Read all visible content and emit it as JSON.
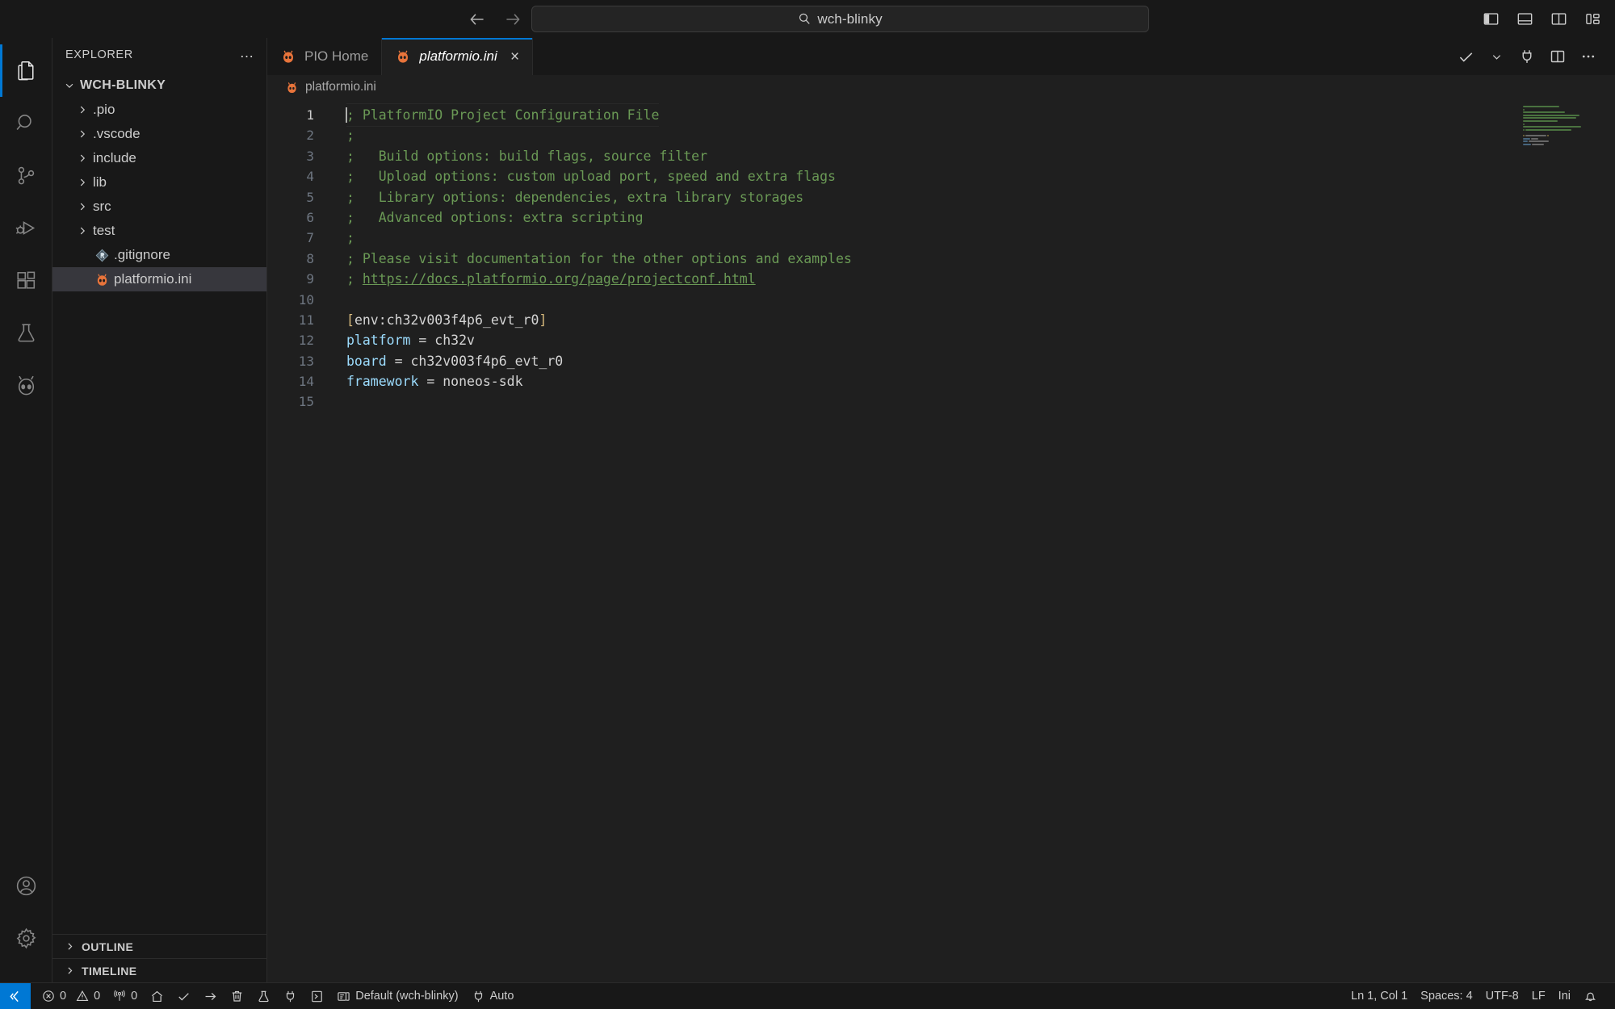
{
  "titlebar": {
    "back_label": "Go Back",
    "forward_label": "Go Forward",
    "search": {
      "value": "wch-blinky",
      "placeholder": "Search",
      "icon": "search-icon"
    },
    "layout_buttons": [
      {
        "name": "toggle-primary-sidebar",
        "label": "Toggle Primary Side Bar"
      },
      {
        "name": "toggle-panel",
        "label": "Toggle Panel"
      },
      {
        "name": "toggle-secondary-sidebar",
        "label": "Toggle Secondary Side Bar"
      },
      {
        "name": "customize-layout",
        "label": "Customize Layout"
      }
    ]
  },
  "activitybar": {
    "items": [
      {
        "name": "explorer",
        "icon": "files-icon",
        "label": "Explorer",
        "active": true
      },
      {
        "name": "search",
        "icon": "search-icon",
        "label": "Search",
        "active": false
      },
      {
        "name": "source-control",
        "icon": "source-control-icon",
        "label": "Source Control",
        "active": false
      },
      {
        "name": "run-and-debug",
        "icon": "debug-icon",
        "label": "Run and Debug",
        "active": false
      },
      {
        "name": "extensions",
        "icon": "extensions-icon",
        "label": "Extensions",
        "active": false
      },
      {
        "name": "testing",
        "icon": "beaker-icon",
        "label": "Testing",
        "active": false
      },
      {
        "name": "platformio",
        "icon": "platformio-alien-icon",
        "label": "PlatformIO",
        "active": false
      }
    ],
    "bottom_items": [
      {
        "name": "accounts",
        "icon": "account-icon",
        "label": "Accounts"
      },
      {
        "name": "manage",
        "icon": "gear-icon",
        "label": "Manage"
      }
    ]
  },
  "sidebar": {
    "title": "EXPLORER",
    "more_actions": "…",
    "root": {
      "label": "WCH-BLINKY",
      "expanded": true
    },
    "tree": [
      {
        "label": ".pio",
        "type": "folder",
        "expanded": false,
        "selected": false
      },
      {
        "label": ".vscode",
        "type": "folder",
        "expanded": false,
        "selected": false
      },
      {
        "label": "include",
        "type": "folder",
        "expanded": false,
        "selected": false
      },
      {
        "label": "lib",
        "type": "folder",
        "expanded": false,
        "selected": false
      },
      {
        "label": "src",
        "type": "folder",
        "expanded": false,
        "selected": false
      },
      {
        "label": "test",
        "type": "folder",
        "expanded": false,
        "selected": false
      },
      {
        "label": ".gitignore",
        "type": "file",
        "icon": "git-icon",
        "selected": false
      },
      {
        "label": "platformio.ini",
        "type": "file",
        "icon": "platformio-alien-icon",
        "selected": true
      }
    ],
    "sections": [
      {
        "label": "OUTLINE",
        "expanded": false
      },
      {
        "label": "TIMELINE",
        "expanded": false
      }
    ]
  },
  "editor": {
    "tabs": [
      {
        "label": "PIO Home",
        "icon": "platformio-alien-icon",
        "active": false,
        "closable": false
      },
      {
        "label": "platformio.ini",
        "icon": "platformio-alien-icon",
        "active": true,
        "closable": true,
        "close_label": "×"
      }
    ],
    "actions": [
      {
        "name": "pio-build",
        "icon": "check-icon",
        "label": "PlatformIO: Build"
      },
      {
        "name": "pio-build-dropdown",
        "icon": "chevron-down-icon",
        "label": "More build tasks"
      },
      {
        "name": "serial-monitor",
        "icon": "plug-icon",
        "label": "Serial Monitor"
      },
      {
        "name": "split-editor",
        "icon": "split-editor-icon",
        "label": "Split Editor Right"
      },
      {
        "name": "more-actions",
        "icon": "ellipsis-icon",
        "label": "More Actions..."
      }
    ],
    "breadcrumb": {
      "icon": "platformio-alien-icon",
      "label": "platformio.ini"
    },
    "language_colors": {
      "comment": "#6a9955",
      "key": "#9cdcfe",
      "value": "#d4d4d4",
      "bracket": "#d7ba7d",
      "background": "#1f1f1f",
      "line_number": "#6e7681",
      "accent": "#0078d4"
    },
    "lines": [
      {
        "n": 1,
        "current": true,
        "caret": true,
        "tokens": [
          {
            "t": "; PlatformIO Project Configuration File",
            "c": "cm"
          }
        ]
      },
      {
        "n": 2,
        "tokens": [
          {
            "t": ";",
            "c": "cm"
          }
        ]
      },
      {
        "n": 3,
        "tokens": [
          {
            "t": ";   Build options: build flags, source filter",
            "c": "cm"
          }
        ]
      },
      {
        "n": 4,
        "tokens": [
          {
            "t": ";   Upload options: custom upload port, speed and extra flags",
            "c": "cm"
          }
        ]
      },
      {
        "n": 5,
        "tokens": [
          {
            "t": ";   Library options: dependencies, extra library storages",
            "c": "cm"
          }
        ]
      },
      {
        "n": 6,
        "tokens": [
          {
            "t": ";   Advanced options: extra scripting",
            "c": "cm"
          }
        ]
      },
      {
        "n": 7,
        "tokens": [
          {
            "t": ";",
            "c": "cm"
          }
        ]
      },
      {
        "n": 8,
        "tokens": [
          {
            "t": "; Please visit documentation for the other options and examples",
            "c": "cm"
          }
        ]
      },
      {
        "n": 9,
        "tokens": [
          {
            "t": "; ",
            "c": "cm"
          },
          {
            "t": "https://docs.platformio.org/page/projectconf.html",
            "c": "clink"
          }
        ]
      },
      {
        "n": 10,
        "tokens": []
      },
      {
        "n": 11,
        "tokens": [
          {
            "t": "[",
            "c": "cbr"
          },
          {
            "t": "env:ch32v003f4p6_evt_r0",
            "c": "cs"
          },
          {
            "t": "]",
            "c": "cbr"
          }
        ]
      },
      {
        "n": 12,
        "tokens": [
          {
            "t": "platform",
            "c": "ck"
          },
          {
            "t": " = ch32v",
            "c": "cs"
          }
        ]
      },
      {
        "n": 13,
        "tokens": [
          {
            "t": "board",
            "c": "ck"
          },
          {
            "t": " = ch32v003f4p6_evt_r0",
            "c": "cs"
          }
        ]
      },
      {
        "n": 14,
        "tokens": [
          {
            "t": "framework",
            "c": "ck"
          },
          {
            "t": " = noneos-sdk",
            "c": "cs"
          }
        ]
      },
      {
        "n": 15,
        "tokens": []
      }
    ]
  },
  "statusbar": {
    "remote": {
      "icon": "remote-icon",
      "label": "Open a Remote Window"
    },
    "left": [
      {
        "name": "problems",
        "icon": "error-icon",
        "text": "0",
        "second_icon": "warning-icon",
        "second_text": "0"
      },
      {
        "name": "pio-ports",
        "icon": "radio-tower-icon",
        "text": "0"
      },
      {
        "name": "pio-home",
        "icon": "home-icon",
        "text": ""
      },
      {
        "name": "pio-build",
        "icon": "check-icon",
        "text": ""
      },
      {
        "name": "pio-upload",
        "icon": "arrow-right-icon",
        "text": ""
      },
      {
        "name": "pio-clean",
        "icon": "trash-icon",
        "text": ""
      },
      {
        "name": "pio-test",
        "icon": "beaker-icon",
        "text": ""
      },
      {
        "name": "pio-serial-monitor",
        "icon": "plug-icon",
        "text": ""
      },
      {
        "name": "pio-terminal",
        "icon": "terminal-icon",
        "text": ""
      },
      {
        "name": "pio-project-env",
        "icon": "folder-env-icon",
        "text": "Default (wch-blinky)"
      },
      {
        "name": "pio-port-auto",
        "icon": "plug-icon",
        "text": "Auto"
      }
    ],
    "right": [
      {
        "name": "editor-position",
        "text": "Ln 1, Col 1"
      },
      {
        "name": "editor-indentation",
        "text": "Spaces: 4"
      },
      {
        "name": "editor-encoding",
        "text": "UTF-8"
      },
      {
        "name": "editor-eol",
        "text": "LF"
      },
      {
        "name": "editor-language",
        "text": "Ini"
      },
      {
        "name": "notifications",
        "icon": "bell-icon",
        "text": ""
      }
    ]
  }
}
